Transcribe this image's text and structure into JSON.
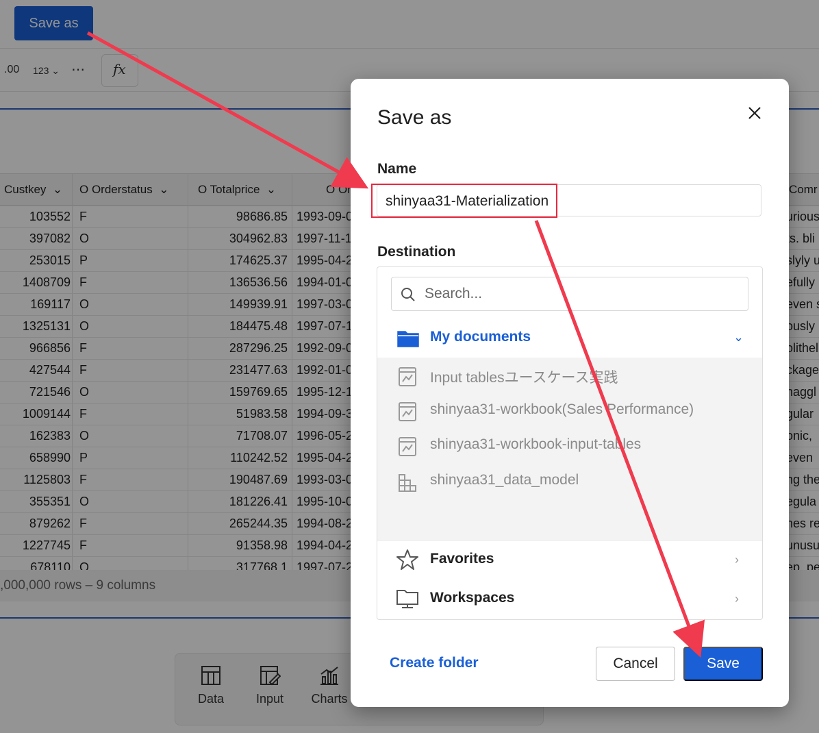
{
  "header": {
    "save_as_button": "Save as"
  },
  "toolbar": {
    "decimal": ".00",
    "number_format": "123",
    "more": "⋯",
    "formula": "fx"
  },
  "table": {
    "columns": [
      "Custkey",
      "O Orderstatus",
      "O Totalprice",
      "O Or",
      "Comr"
    ],
    "rows": [
      [
        "103552",
        "F",
        "98686.85",
        "1993-09-0",
        "urious"
      ],
      [
        "397082",
        "O",
        "304962.83",
        "1997-11-1",
        "ts. bli"
      ],
      [
        "253015",
        "P",
        "174625.37",
        "1995-04-2",
        "slyly u"
      ],
      [
        "1408709",
        "F",
        "136536.56",
        "1994-01-0",
        "efully"
      ],
      [
        "169117",
        "O",
        "149939.91",
        "1997-03-0",
        "even s"
      ],
      [
        "1325131",
        "O",
        "184475.48",
        "1997-07-1",
        "ously"
      ],
      [
        "966856",
        "F",
        "287296.25",
        "1992-09-0",
        "olithel"
      ],
      [
        "427544",
        "F",
        "231477.63",
        "1992-01-0",
        "ckage"
      ],
      [
        "721546",
        "O",
        "159769.65",
        "1995-12-1",
        "haggl"
      ],
      [
        "1009144",
        "F",
        "51983.58",
        "1994-09-3",
        "gular"
      ],
      [
        "162383",
        "O",
        "71708.07",
        "1996-05-2",
        "onic,"
      ],
      [
        "658990",
        "P",
        "110242.52",
        "1995-04-2",
        "even"
      ],
      [
        "1125803",
        "F",
        "190487.69",
        "1993-03-0",
        "ng the"
      ],
      [
        "355351",
        "O",
        "181226.41",
        "1995-10-0",
        "egula"
      ],
      [
        "879262",
        "F",
        "265244.35",
        "1994-08-2",
        "nes re"
      ],
      [
        "1227745",
        "F",
        "91358.98",
        "1994-04-2",
        "unusu"
      ],
      [
        "678110",
        "O",
        "317768.1",
        "1997-07-2",
        "ep. pe"
      ]
    ],
    "footer": ",000,000 rows – 9 columns"
  },
  "dock": {
    "items": [
      "Data",
      "Input",
      "Charts"
    ]
  },
  "dialog": {
    "title": "Save as",
    "name_label": "Name",
    "name_value": "shinyaa31-Materialization",
    "destination_label": "Destination",
    "search_placeholder": "Search...",
    "my_documents": "My documents",
    "documents": [
      "Input tablesユースケース実践",
      "shinyaa31-workbook(Sales Performance)",
      "shinyaa31-workbook-input-tables",
      "shinyaa31_data_model"
    ],
    "favorites": "Favorites",
    "workspaces": "Workspaces",
    "create_folder": "Create folder",
    "cancel": "Cancel",
    "save": "Save"
  },
  "colors": {
    "accent": "#1a5fd6",
    "annotation": "#e8283f"
  }
}
